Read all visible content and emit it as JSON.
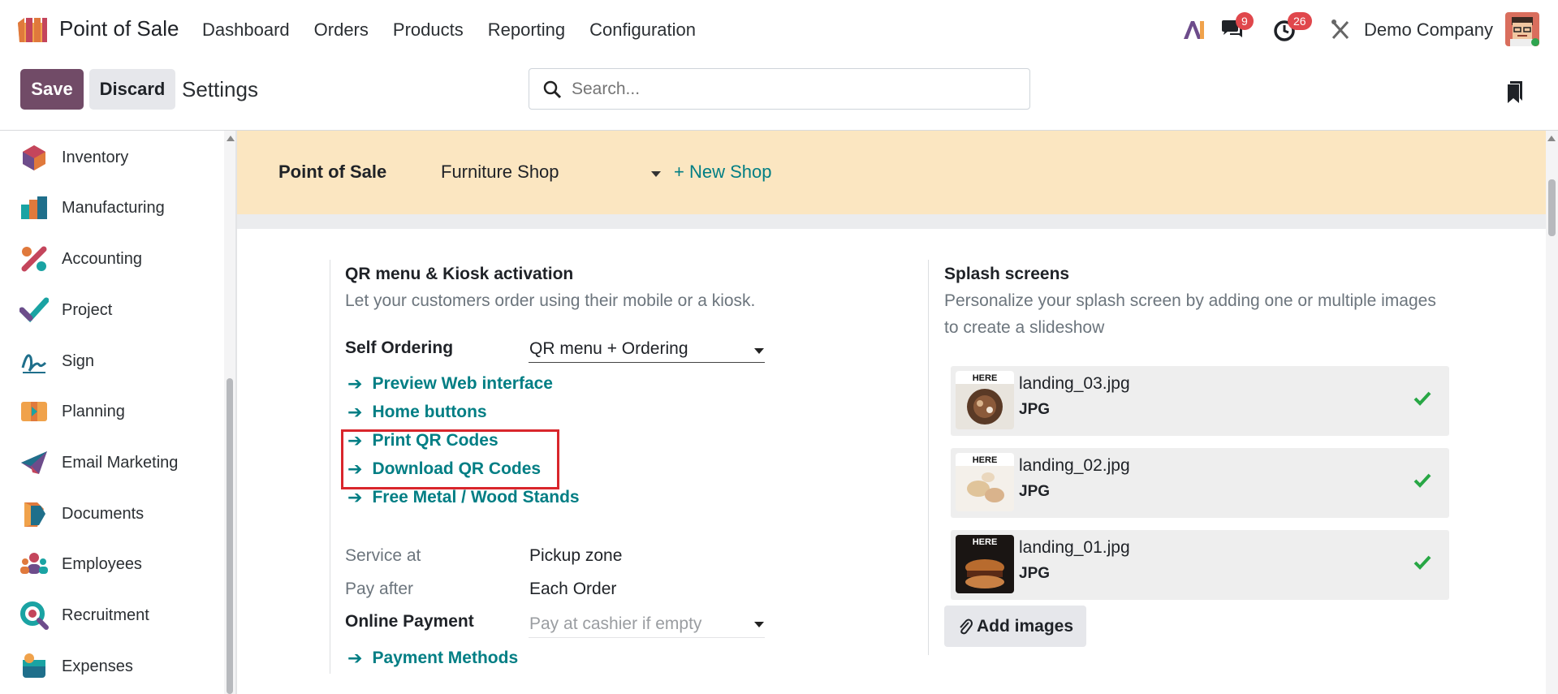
{
  "navbar": {
    "app_name": "Point of Sale",
    "menu": [
      "Dashboard",
      "Orders",
      "Products",
      "Reporting",
      "Configuration"
    ],
    "messages_count": "9",
    "activities_count": "26",
    "company": "Demo Company"
  },
  "control": {
    "save_label": "Save",
    "discard_label": "Discard",
    "title": "Settings",
    "search_placeholder": "Search..."
  },
  "sidebar": {
    "items": [
      {
        "label": "Inventory",
        "icon": "inventory-icon"
      },
      {
        "label": "Manufacturing",
        "icon": "manufacturing-icon"
      },
      {
        "label": "Accounting",
        "icon": "accounting-icon"
      },
      {
        "label": "Project",
        "icon": "project-icon"
      },
      {
        "label": "Sign",
        "icon": "sign-icon"
      },
      {
        "label": "Planning",
        "icon": "planning-icon"
      },
      {
        "label": "Email Marketing",
        "icon": "email-marketing-icon"
      },
      {
        "label": "Documents",
        "icon": "documents-icon"
      },
      {
        "label": "Employees",
        "icon": "employees-icon"
      },
      {
        "label": "Recruitment",
        "icon": "recruitment-icon"
      },
      {
        "label": "Expenses",
        "icon": "expenses-icon"
      }
    ]
  },
  "shop_band": {
    "label": "Point of Sale",
    "shop": "Furniture Shop",
    "new_shop": "+ New Shop"
  },
  "qr_section": {
    "title": "QR menu & Kiosk activation",
    "description": "Let your customers order using their mobile or a kiosk.",
    "self_ordering_label": "Self Ordering",
    "self_ordering_value": "QR menu + Ordering",
    "links": [
      "Preview Web interface",
      "Home buttons",
      "Print QR Codes",
      "Download QR Codes",
      "Free Metal / Wood Stands"
    ],
    "service_at_label": "Service at",
    "service_at_value": "Pickup zone",
    "pay_after_label": "Pay after",
    "pay_after_value": "Each Order",
    "online_payment_label": "Online Payment",
    "online_payment_placeholder": "Pay at cashier if empty",
    "payment_methods": "Payment Methods"
  },
  "splash": {
    "title": "Splash screens",
    "description_line1": "Personalize your splash screen by adding one or multiple images",
    "description_line2": "to create a slideshow",
    "images": [
      {
        "name": "landing_03.jpg",
        "type": "JPG",
        "thumb_text": "HERE"
      },
      {
        "name": "landing_02.jpg",
        "type": "JPG",
        "thumb_text": "HERE"
      },
      {
        "name": "landing_01.jpg",
        "type": "JPG",
        "thumb_text": "HERE"
      }
    ],
    "add_images": "Add images"
  },
  "colors": {
    "brand": "#714b67",
    "link": "#017e84",
    "band": "#fbe6c1",
    "highlight": "#d9262c",
    "badge": "#e0474c"
  }
}
